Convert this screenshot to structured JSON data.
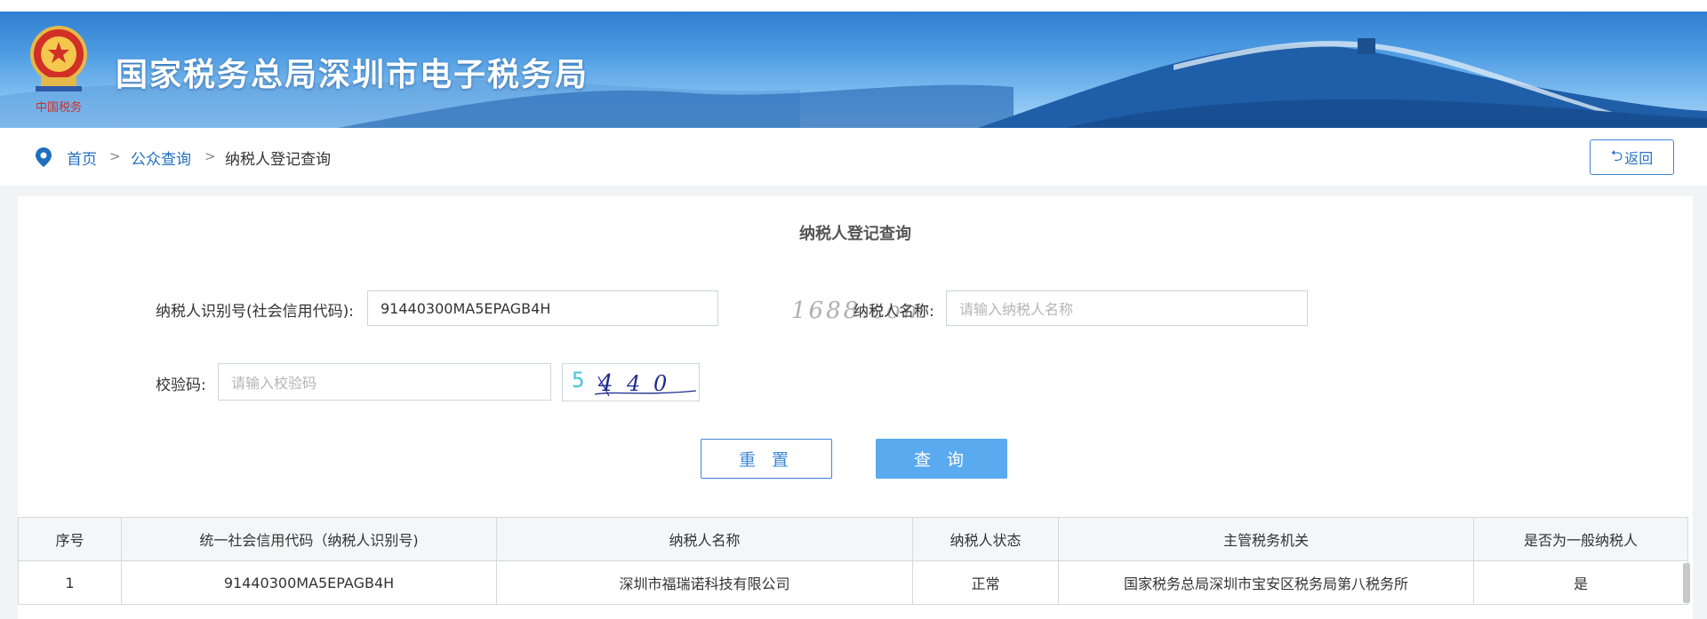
{
  "header": {
    "site_title": "国家税务总局深圳市电子税务局",
    "emblem_text": "中国税务"
  },
  "breadcrumb": {
    "items": [
      {
        "label": "首页"
      },
      {
        "label": "公众查询"
      },
      {
        "label": "纳税人登记查询"
      }
    ],
    "separator": ">"
  },
  "back_button": {
    "label": "返回",
    "icon": "return-arrow-icon"
  },
  "form": {
    "title": "纳税人登记查询",
    "taxpayer_id_label": "纳税人识别号(社会信用代码):",
    "taxpayer_id_value": "91440300MA5EPAGB4H",
    "taxpayer_name_label": "纳税人名称:",
    "taxpayer_name_placeholder": "请输入纳税人名称",
    "verify_code_label": "校验码:",
    "verify_code_placeholder": "请输入校验码",
    "captcha_digits": [
      "5",
      "4",
      "4",
      "0"
    ],
    "watermark": "1688.com",
    "reset_label": "重 置",
    "query_label": "查 询"
  },
  "table": {
    "columns": [
      "序号",
      "统一社会信用代码（纳税人识别号)",
      "纳税人名称",
      "纳税人状态",
      "主管税务机关",
      "是否为一般纳税人"
    ],
    "rows": [
      [
        "1",
        "91440300MA5EPAGB4H",
        "深圳市福瑞诺科技有限公司",
        "正常",
        "国家税务总局深圳市宝安区税务局第八税务所",
        "是"
      ]
    ]
  },
  "colors": {
    "accent_blue": "#3b86d6",
    "query_button": "#5aaaf0",
    "link_blue": "#1f6fc0",
    "banner_top": "#2f7fd1"
  }
}
